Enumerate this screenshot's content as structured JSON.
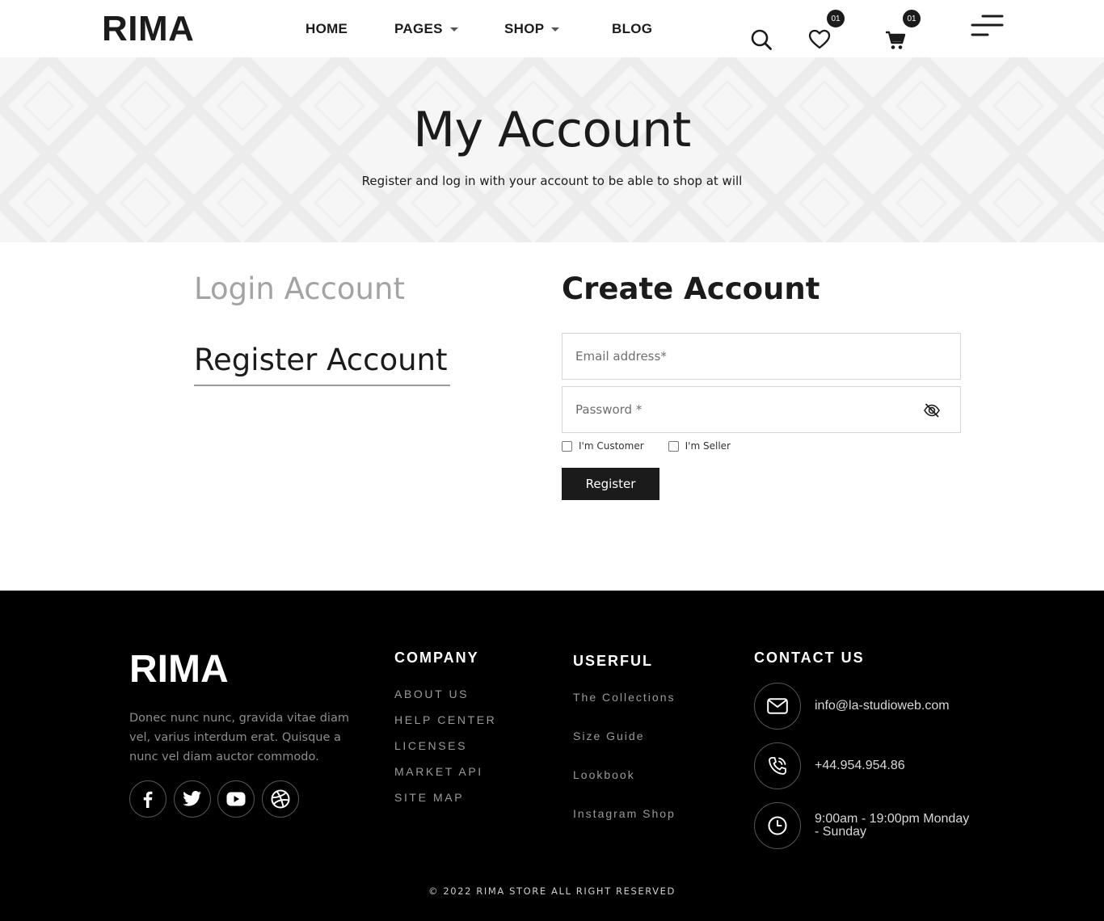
{
  "header": {
    "logo": "RIMA",
    "nav": [
      {
        "label": "HOME"
      },
      {
        "label": "PAGES"
      },
      {
        "label": "SHOP"
      },
      {
        "label": "BLOG"
      }
    ],
    "wishlist_count": "01",
    "cart_count": "01",
    "icons": [
      "search-icon",
      "heart-icon",
      "cart-icon",
      "menu-icon"
    ]
  },
  "hero": {
    "title": "My Account",
    "subtitle": "Register and log in with your account to be able to shop at will"
  },
  "tabs": {
    "login": "Login Account",
    "register": "Register Account"
  },
  "form": {
    "title": "Create Account",
    "email_placeholder": "Email address*",
    "password_placeholder": "Password *",
    "customer_label": "I'm Customer",
    "seller_label": "I'm Seller",
    "submit_label": "Register"
  },
  "footer": {
    "logo": "RIMA",
    "description": "Donec nunc nunc, gravida vitae diam vel, varius interdum erat. Quisque a nunc vel diam auctor commodo.",
    "social": [
      "facebook-icon",
      "twitter-icon",
      "youtube-icon",
      "dribbble-icon"
    ],
    "company": {
      "heading": "COMPANY",
      "links": [
        "ABOUT US",
        "HELP CENTER",
        "LICENSES",
        "MARKET API",
        "SITE MAP"
      ]
    },
    "useful": {
      "heading": "USERFUL",
      "links": [
        "The Collections",
        "Size Guide",
        "Lookbook",
        "Instagram Shop"
      ]
    },
    "contact": {
      "heading": "CONTACT US",
      "email": "info@la-studioweb.com",
      "phone": "+44.954.954.86",
      "hours": "9:00am - 19:00pm Monday - Sunday"
    },
    "copyright": "© 2022 RIMA STORE ALL RIGHT RESERVED"
  }
}
